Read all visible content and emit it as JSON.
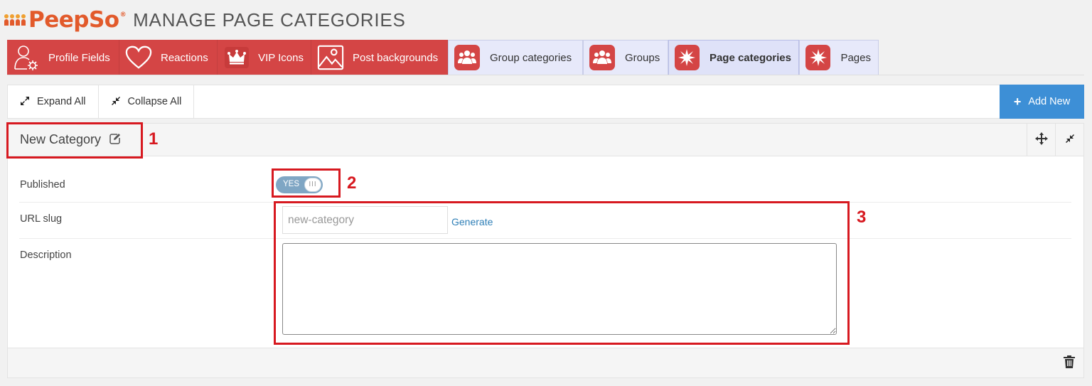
{
  "header": {
    "logo_text": "PeepSo",
    "logo_mark": "®",
    "title": "MANAGE PAGE CATEGORIES"
  },
  "tabs": [
    {
      "label": "Profile Fields",
      "icon": "profile-gear-icon",
      "style": "red"
    },
    {
      "label": "Reactions",
      "icon": "heart-icon",
      "style": "red"
    },
    {
      "label": "VIP Icons",
      "icon": "crown-icon",
      "style": "red"
    },
    {
      "label": "Post backgrounds",
      "icon": "image-icon",
      "style": "red"
    },
    {
      "label": "Group categories",
      "icon": "users-icon",
      "style": "blue"
    },
    {
      "label": "Groups",
      "icon": "users-icon",
      "style": "blue"
    },
    {
      "label": "Page categories",
      "icon": "star-burst-icon",
      "style": "blue",
      "active": true
    },
    {
      "label": "Pages",
      "icon": "star-burst-icon",
      "style": "blue"
    }
  ],
  "toolbar": {
    "expand_all": "Expand All",
    "collapse_all": "Collapse All",
    "add_new": "Add New"
  },
  "category": {
    "title": "New Category",
    "published_label": "Published",
    "published_value": "YES",
    "toggle_knob": "III",
    "slug_label": "URL slug",
    "slug_placeholder": "new-category",
    "generate_label": "Generate",
    "description_label": "Description",
    "description_value": ""
  },
  "annotations": [
    "1",
    "2",
    "3"
  ],
  "colors": {
    "accent_red": "#d44545",
    "tab_blue": "#e7e9fa",
    "add_new_blue": "#3d8fd6",
    "annotation_red": "#d71920",
    "logo_orange": "#e25a2b"
  }
}
